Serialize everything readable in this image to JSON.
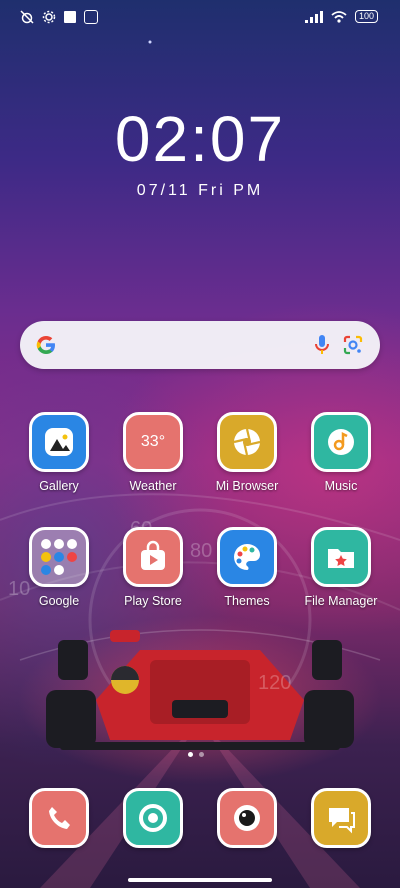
{
  "status_bar": {
    "battery": "100"
  },
  "clock": {
    "time": "02:07",
    "date": "07/11 Fri PM"
  },
  "apps": [
    {
      "label": "Gallery"
    },
    {
      "label": "Weather",
      "temp": "33°"
    },
    {
      "label": "Mi Browser"
    },
    {
      "label": "Music"
    },
    {
      "label": "Google"
    },
    {
      "label": "Play Store"
    },
    {
      "label": "Themes"
    },
    {
      "label": "File Manager"
    }
  ],
  "wallpaper_numbers": [
    "10",
    "60",
    "80",
    "120"
  ],
  "colors": {
    "salmon": "#e5736e",
    "teal": "#2fb7a1",
    "mustard": "#d9a92a",
    "blue": "#2a86e4"
  }
}
